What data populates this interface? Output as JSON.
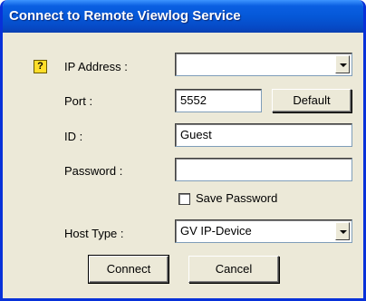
{
  "window": {
    "title": "Connect to Remote Viewlog Service"
  },
  "form": {
    "help_icon": "question-mark-icon",
    "ip_address": {
      "label": "IP Address :",
      "value": ""
    },
    "port": {
      "label": "Port :",
      "value": "5552",
      "default_button": "Default"
    },
    "id": {
      "label": "ID :",
      "value": "Guest"
    },
    "password": {
      "label": "Password :",
      "value": ""
    },
    "save_password": {
      "label": "Save Password",
      "checked": false
    },
    "host_type": {
      "label": "Host Type :",
      "value": "GV IP-Device"
    }
  },
  "buttons": {
    "connect": "Connect",
    "cancel": "Cancel"
  },
  "colors": {
    "title_bar": "#0558d8",
    "dialog_face": "#ece9d8",
    "frame": "#0831d9"
  }
}
